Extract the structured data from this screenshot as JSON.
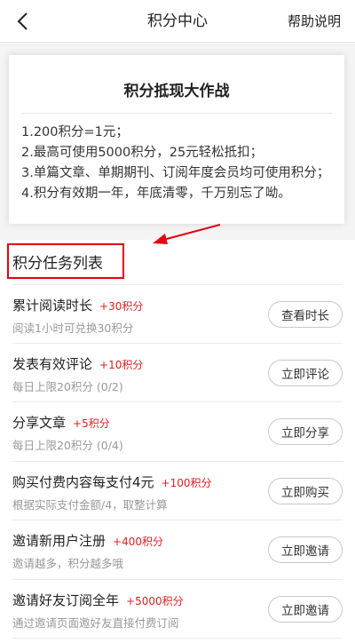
{
  "header": {
    "back_icon": "chevron-left-icon",
    "title": "积分中心",
    "help_label": "帮助说明"
  },
  "rules": {
    "title": "积分抵现大作战",
    "lines": [
      "1.200积分=1元；",
      "2.最高可使用5000积分，25元轻松抵扣；",
      "3.单篇文章、单期期刊、订阅年度会员均可使用积分；",
      "4.积分有效期一年，年底清零，千万别忘了呦。"
    ]
  },
  "annotation": {
    "color": "#e60012"
  },
  "tasks": {
    "header": "积分任务列表",
    "items": [
      {
        "name": "累计阅读时长",
        "points": "+30积分",
        "desc": "阅读1小时可兑换30积分",
        "button": "查看时长"
      },
      {
        "name": "发表有效评论",
        "points": "+10积分",
        "desc": "每日上限20积分 (0/2)",
        "button": "立即评论"
      },
      {
        "name": "分享文章",
        "points": "+5积分",
        "desc": "每日上限20积分 (0/4)",
        "button": "立即分享"
      },
      {
        "name": "购买付费内容每支付4元",
        "points": "+100积分",
        "desc": "根据实际支付金额/4，取整计算",
        "button": "立即购买"
      },
      {
        "name": "邀请新用户注册",
        "points": "+400积分",
        "desc": "邀请越多，积分越多哦",
        "button": "立即邀请"
      },
      {
        "name": "邀请好友订阅全年",
        "points": "+5000积分",
        "desc": "通过邀请页面邀好友直接付费订阅",
        "button": "立即邀请"
      }
    ]
  },
  "colors": {
    "accent_red": "#e02020",
    "highlight_red": "#e60012"
  }
}
